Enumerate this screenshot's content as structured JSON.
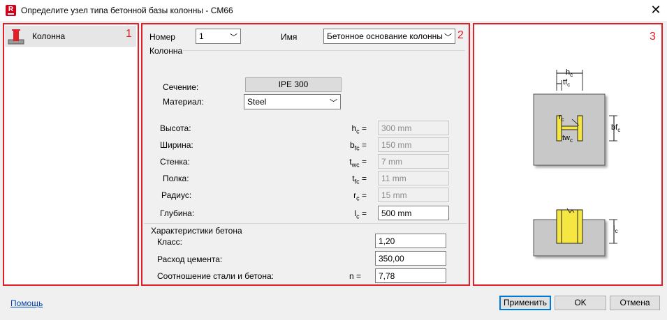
{
  "window": {
    "title": "Определите узел типа бетонной базы колонны - CM66",
    "app_icon_letter": "R"
  },
  "panels": {
    "num1": "1",
    "num2": "2",
    "num3": "3"
  },
  "tree": {
    "item_label": "Колонна"
  },
  "header": {
    "number_label": "Номер",
    "number_value": "1",
    "name_label": "Имя",
    "name_value": "Бетонное основание колонны"
  },
  "column_group": {
    "title": "Колонна",
    "section_label": "Сечение:",
    "section_value": "IPE 300",
    "material_label": "Материал:",
    "material_value": "Steel",
    "rows": [
      {
        "label": "Высота:",
        "sym": "h",
        "sub": "c",
        "eq": "=",
        "value": "300 mm",
        "enabled": false
      },
      {
        "label": "Ширина:",
        "sym": "b",
        "sub": "fc",
        "eq": "=",
        "value": "150 mm",
        "enabled": false
      },
      {
        "label": "Стенка:",
        "sym": "t",
        "sub": "wc",
        "eq": "=",
        "value": "7 mm",
        "enabled": false
      },
      {
        "label": "Полка:",
        "sym": "t",
        "sub": "fc",
        "eq": "=",
        "value": "11 mm",
        "enabled": false
      },
      {
        "label": "Радиус:",
        "sym": "r",
        "sub": "c",
        "eq": "=",
        "value": "15 mm",
        "enabled": false
      },
      {
        "label": "Глубина:",
        "sym": "l",
        "sub": "c",
        "eq": "=",
        "value": "500 mm",
        "enabled": true
      }
    ]
  },
  "concrete_group": {
    "title": "Характеристики бетона",
    "class_label": "Класс:",
    "class_value": "1,20",
    "cement_label": "Расход цемента:",
    "cement_value": "350,00",
    "ratio_label": "Соотношение стали и бетона:",
    "ratio_sym": "n =",
    "ratio_value": "7,78"
  },
  "diagram": {
    "hc": "h",
    "hc_sub": "c",
    "tfc": "tf",
    "tfc_sub": "c",
    "bfc": "bf",
    "bfc_sub": "c",
    "rc": "r",
    "rc_sub": "c",
    "twc": "tw",
    "twc_sub": "c",
    "lc": "l",
    "lc_sub": "c",
    "colors": {
      "concrete": "#c8c8c8",
      "steel": "#f5e642",
      "dim": "#000000"
    }
  },
  "footer": {
    "help_label": "Помощь",
    "apply_label": "Применить",
    "ok_label": "OK",
    "cancel_label": "Отмена"
  }
}
